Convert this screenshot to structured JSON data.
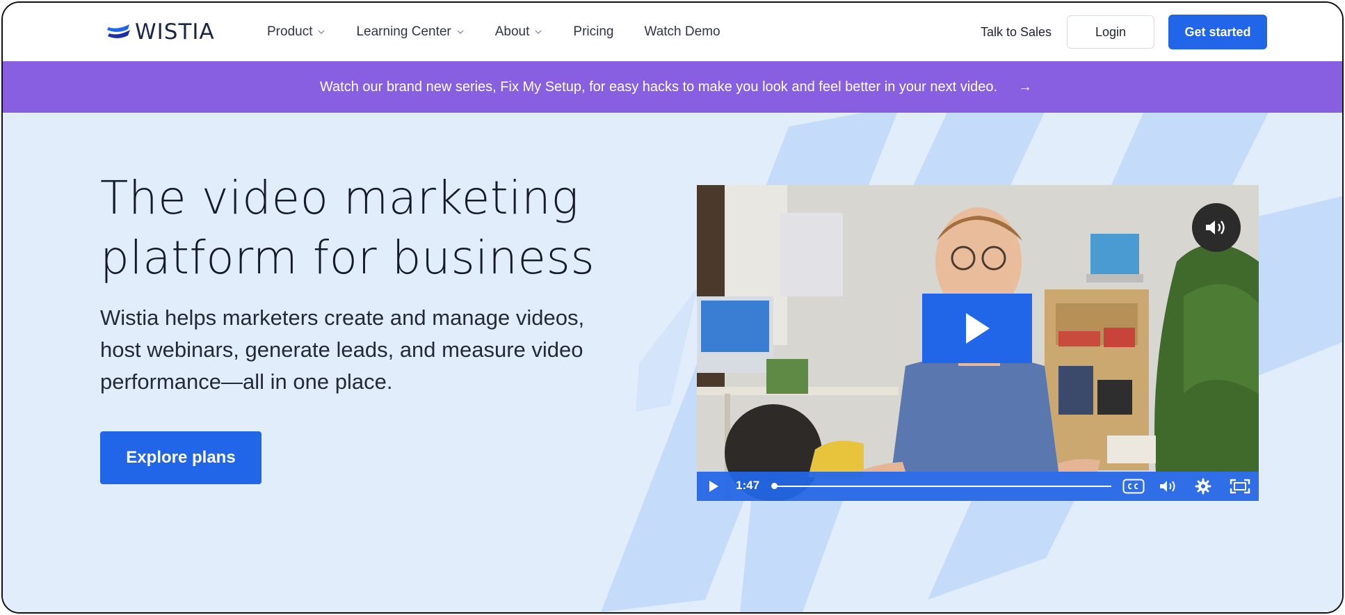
{
  "brand": {
    "name": "WISTIA",
    "accent": "#2166e8",
    "banner_color": "#875fe0",
    "hero_bg": "#e2edfc"
  },
  "nav": {
    "items": [
      {
        "label": "Product",
        "has_dropdown": true
      },
      {
        "label": "Learning Center",
        "has_dropdown": true
      },
      {
        "label": "About",
        "has_dropdown": true
      },
      {
        "label": "Pricing",
        "has_dropdown": false
      },
      {
        "label": "Watch Demo",
        "has_dropdown": false
      }
    ],
    "talk_to_sales": "Talk to Sales",
    "login": "Login",
    "get_started": "Get started"
  },
  "banner": {
    "text": "Watch our brand new series, Fix My Setup, for easy hacks to make you look and feel better in your next video.",
    "arrow": "→"
  },
  "hero": {
    "headline_line1": "The video marketing",
    "headline_line2": "platform for business",
    "subtext": "Wistia helps marketers create and manage videos, host webinars, generate leads, and measure video performance—all in one place.",
    "cta": "Explore plans"
  },
  "video": {
    "duration": "1:47",
    "icons": [
      "volume-icon",
      "play-icon",
      "closed-captions-icon",
      "settings-icon",
      "fullscreen-icon"
    ]
  }
}
